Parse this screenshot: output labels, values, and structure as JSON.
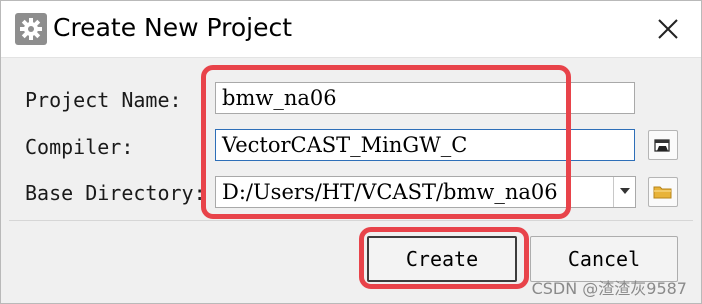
{
  "window": {
    "title": "Create New Project",
    "app_icon": "gear-icon",
    "close_icon": "close-icon"
  },
  "form": {
    "project_name_label": "Project Name:",
    "project_name_value": "bmw_na06",
    "compiler_label": "Compiler:",
    "compiler_value": "VectorCAST_MinGW_C",
    "compiler_browse_icon": "file-open-icon",
    "base_dir_label": "Base Directory:",
    "base_dir_value": "D:/Users/HT/VCAST/bmw_na06",
    "base_dir_dropdown_icon": "chevron-down-icon",
    "base_dir_browse_icon": "folder-icon"
  },
  "buttons": {
    "create_label": "Create",
    "cancel_label": "Cancel"
  },
  "watermark": "CSDN @渣渣灰9587",
  "colors": {
    "highlight": "#e8434a",
    "focus_border": "#2e6fb8",
    "folder": "#e8b339"
  }
}
